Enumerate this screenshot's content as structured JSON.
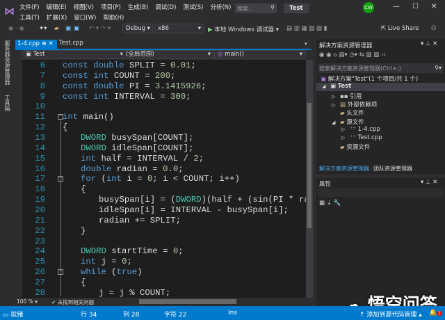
{
  "titlebar": {
    "menu_row1": [
      "文件(F)",
      "编辑(E)",
      "视图(V)",
      "项目(P)",
      "生成(B)",
      "调试(D)",
      "测试(S)",
      "分析(N)"
    ],
    "menu_row2": [
      "工具(T)",
      "扩展(X)",
      "窗口(W)",
      "帮助(H)"
    ],
    "search_placeholder": "搜索...",
    "title": "Test",
    "user_initials": "CW"
  },
  "toolbar": {
    "config": "Debug",
    "platform": "x86",
    "run_label": "本地 Windows 调试器",
    "live_share": "Live Share"
  },
  "left_strip": {
    "server_explorer": "服务器资源管理器",
    "toolbox": "工具箱"
  },
  "tabs": [
    {
      "label": "1-4.cpp",
      "active": true
    },
    {
      "label": "Test.cpp",
      "active": false
    }
  ],
  "navbar": {
    "project": "Test",
    "scope": "(全局范围)",
    "member": "main()"
  },
  "editor": {
    "lines": [
      {
        "n": "6",
        "ind": 0,
        "seg": [
          [
            "kw",
            "const "
          ],
          [
            "kw",
            "double "
          ],
          [
            "pl",
            "SPLIT = "
          ],
          [
            "nm",
            "0.01"
          ],
          [
            "pl",
            ";"
          ]
        ]
      },
      {
        "n": "7",
        "ind": 0,
        "seg": [
          [
            "kw",
            "const "
          ],
          [
            "kw",
            "int "
          ],
          [
            "pl",
            "COUNT = "
          ],
          [
            "nm",
            "200"
          ],
          [
            "pl",
            ";"
          ]
        ]
      },
      {
        "n": "8",
        "ind": 0,
        "seg": [
          [
            "kw",
            "const "
          ],
          [
            "kw",
            "double "
          ],
          [
            "pl",
            "PI = "
          ],
          [
            "nm",
            "3.1415926"
          ],
          [
            "pl",
            ";"
          ]
        ]
      },
      {
        "n": "9",
        "ind": 0,
        "seg": [
          [
            "kw",
            "const "
          ],
          [
            "kw",
            "int "
          ],
          [
            "pl",
            "INTERVAL = "
          ],
          [
            "nm",
            "300"
          ],
          [
            "pl",
            ";"
          ]
        ]
      },
      {
        "n": "10",
        "ind": 0,
        "seg": []
      },
      {
        "n": "11",
        "ind": 0,
        "fold": true,
        "seg": [
          [
            "kw",
            "int "
          ],
          [
            "pl",
            "main()"
          ]
        ]
      },
      {
        "n": "12",
        "ind": 0,
        "seg": [
          [
            "pl",
            "{"
          ]
        ]
      },
      {
        "n": "13",
        "ind": 1,
        "seg": [
          [
            "ty",
            "DWORD "
          ],
          [
            "pl",
            "busySpan[COUNT];"
          ]
        ]
      },
      {
        "n": "14",
        "ind": 1,
        "seg": [
          [
            "ty",
            "DWORD "
          ],
          [
            "pl",
            "idleSpan[COUNT];"
          ]
        ]
      },
      {
        "n": "15",
        "ind": 1,
        "seg": [
          [
            "kw",
            "int "
          ],
          [
            "pl",
            "half = INTERVAL / "
          ],
          [
            "nm",
            "2"
          ],
          [
            "pl",
            ";"
          ]
        ]
      },
      {
        "n": "16",
        "ind": 1,
        "seg": [
          [
            "kw",
            "double "
          ],
          [
            "pl",
            "radian = "
          ],
          [
            "nm",
            "0.0"
          ],
          [
            "pl",
            ";"
          ]
        ]
      },
      {
        "n": "17",
        "ind": 1,
        "fold": true,
        "seg": [
          [
            "kw",
            "for "
          ],
          [
            "pl",
            "("
          ],
          [
            "kw",
            "int "
          ],
          [
            "pl",
            "i = "
          ],
          [
            "nm",
            "0"
          ],
          [
            "pl",
            "; i < COUNT; i++)"
          ]
        ]
      },
      {
        "n": "18",
        "ind": 1,
        "seg": [
          [
            "pl",
            "{"
          ]
        ]
      },
      {
        "n": "19",
        "ind": 2,
        "seg": [
          [
            "pl",
            "busySpan[i] = ("
          ],
          [
            "ty",
            "DWORD"
          ],
          [
            "pl",
            ")(half + (sin(PI * radian)"
          ]
        ]
      },
      {
        "n": "20",
        "ind": 2,
        "seg": [
          [
            "pl",
            "idleSpan[i] = INTERVAL - busySpan[i];"
          ]
        ]
      },
      {
        "n": "21",
        "ind": 2,
        "seg": [
          [
            "pl",
            "radian += SPLIT;"
          ]
        ]
      },
      {
        "n": "22",
        "ind": 1,
        "seg": [
          [
            "pl",
            "}"
          ]
        ]
      },
      {
        "n": "23",
        "ind": 0,
        "seg": []
      },
      {
        "n": "24",
        "ind": 1,
        "seg": [
          [
            "ty",
            "DWORD "
          ],
          [
            "pl",
            "startTime = "
          ],
          [
            "nm",
            "0"
          ],
          [
            "pl",
            ";"
          ]
        ]
      },
      {
        "n": "25",
        "ind": 1,
        "seg": [
          [
            "kw",
            "int "
          ],
          [
            "pl",
            "j = "
          ],
          [
            "nm",
            "0"
          ],
          [
            "pl",
            ";"
          ]
        ]
      },
      {
        "n": "26",
        "ind": 1,
        "fold": true,
        "seg": [
          [
            "kw",
            "while "
          ],
          [
            "pl",
            "("
          ],
          [
            "kw",
            "true"
          ],
          [
            "pl",
            ")"
          ]
        ]
      },
      {
        "n": "27",
        "ind": 1,
        "seg": [
          [
            "pl",
            "{"
          ]
        ]
      },
      {
        "n": "28",
        "ind": 2,
        "seg": [
          [
            "pl",
            "j = j % COUNT;"
          ]
        ]
      }
    ],
    "zoom": "100 %",
    "issues": "未找到相关问题"
  },
  "solution_explorer": {
    "title": "解决方案资源管理器",
    "search_placeholder": "搜索解决方案资源管理器(Ctrl+;)",
    "items": [
      {
        "label": "解决方案\"Test\"(1 个项目/共 1 个)",
        "level": 0,
        "arrow": ""
      },
      {
        "label": "Test",
        "level": 0,
        "arrow": "◢",
        "bold": true
      },
      {
        "label": "引用",
        "level": 1,
        "arrow": "▷"
      },
      {
        "label": "外部依赖项",
        "level": 1,
        "arrow": "▷"
      },
      {
        "label": "头文件",
        "level": 1,
        "arrow": ""
      },
      {
        "label": "源文件",
        "level": 1,
        "arrow": "◢"
      },
      {
        "label": "1-4.cpp",
        "level": 2,
        "arrow": "▷"
      },
      {
        "label": "Test.cpp",
        "level": 2,
        "arrow": "▷"
      },
      {
        "label": "资源文件",
        "level": 1,
        "arrow": ""
      }
    ],
    "tab_active": "解决方案资源管理器",
    "tab_other": "团队资源管理器"
  },
  "properties": {
    "title": "属性"
  },
  "status": {
    "ready": "就绪",
    "row": "行 34",
    "col": "列 28",
    "char": "字符 22",
    "mode": "Ins",
    "source_control": "添加到源代码管理",
    "notifications": "1"
  },
  "watermark": "悟空问答",
  "colors": {
    "accent": "#007acc",
    "keyword": "#569cd6",
    "type": "#4ec9b0",
    "number": "#b5cea8",
    "line_number": "#2b91af"
  }
}
